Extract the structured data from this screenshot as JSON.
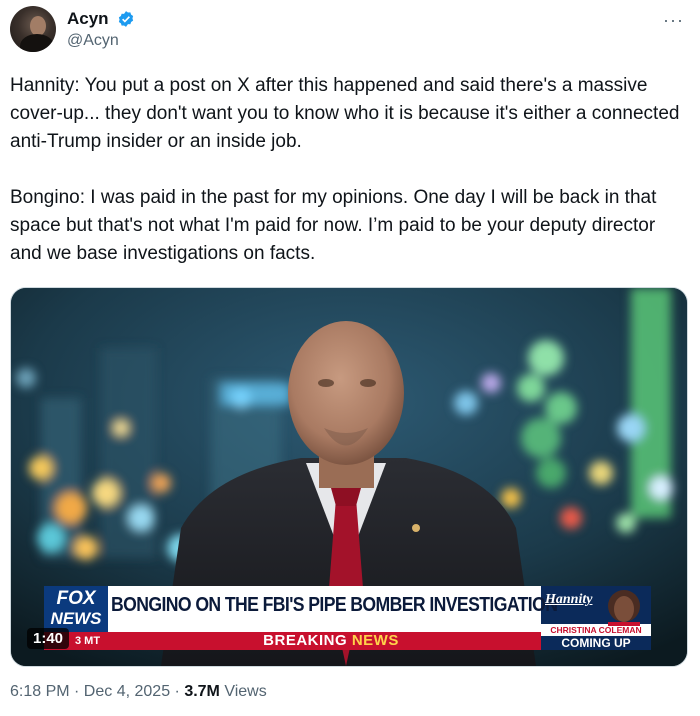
{
  "author": {
    "display_name": "Acyn",
    "handle": "@Acyn",
    "verified_color": "#1d9bf0"
  },
  "tweet": {
    "paragraph1": "Hannity: You put a post on X after this happened and said there's a massive cover-up... they don't want you to know who it is because it's either a connected anti-Trump insider or an inside job.",
    "paragraph2": "Bongino: I was paid in the past for my opinions. One day I will be back in that space but that's not what I'm paid for now. I’m paid to be your deputy director and we base investigations on facts."
  },
  "video": {
    "duration": "1:40",
    "lower_third": {
      "network_line1": "FOX",
      "network_line2": "NEWS",
      "clock": "3 MT",
      "headline": "BONGINO ON THE FBI'S PIPE BOMBER INVESTIGATION",
      "breaking": "BREAKING",
      "breaking_news": "NEWS",
      "show_logo": "Hannity",
      "coming_up_name": "CHRISTINA COLEMAN",
      "coming_up": "COMING UP"
    }
  },
  "meta": {
    "time_date": "6:18 PM · Dec 4, 2025 · ",
    "views_count": "3.7M",
    "views_label": " Views"
  }
}
